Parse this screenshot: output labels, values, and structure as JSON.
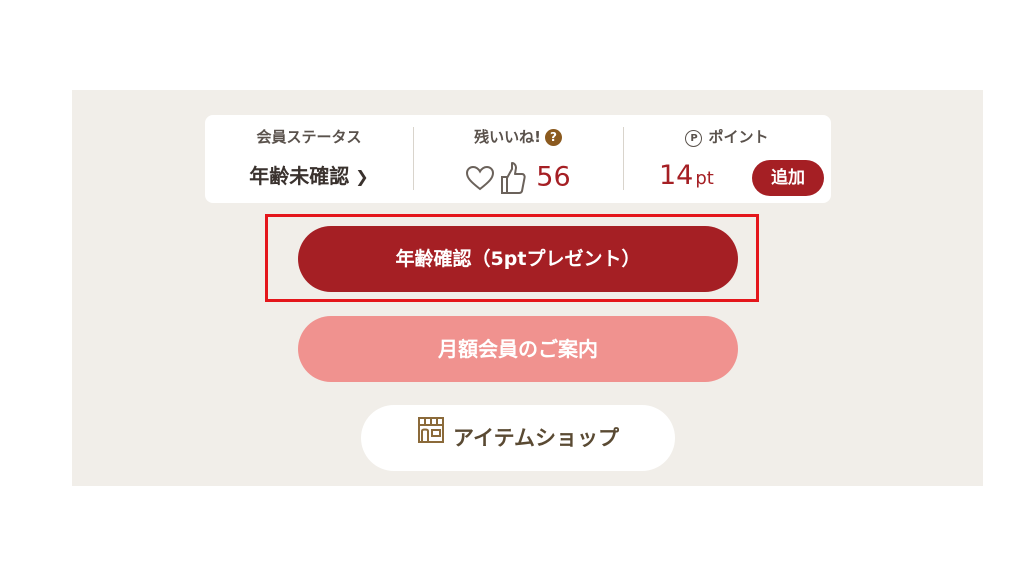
{
  "status": {
    "member_status_label": "会員ステータス",
    "member_status_value": "年齢未確認",
    "likes_label": "残いいね!",
    "likes_help": "?",
    "likes_count": "56",
    "points_symbol": "P",
    "points_label": "ポイント",
    "points_value": "14",
    "points_unit": "pt",
    "add_label": "追加"
  },
  "buttons": {
    "age_verify": "年齢確認（5ptプレゼント）",
    "monthly": "月額会員のご案内",
    "item_shop": "アイテムショップ"
  },
  "colors": {
    "accent": "#a51f24",
    "monthly": "#f0928f",
    "panel_bg": "#f1eee9",
    "highlight": "#e4161b"
  }
}
